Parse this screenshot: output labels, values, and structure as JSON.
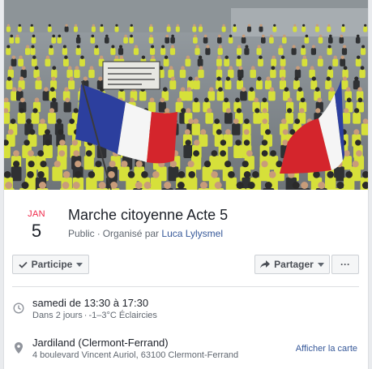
{
  "cover": {
    "banner_text": "",
    "colors": {
      "vest": "#d6e03a",
      "flag_blue": "#2c3f9e",
      "flag_red": "#d4252c",
      "flag_white": "#f5f5f5"
    }
  },
  "event": {
    "month": "JAN",
    "day": "5",
    "title": "Marche citoyenne Acte 5",
    "privacy": "Public",
    "separator": "·",
    "organized_by": "Organisé par",
    "host": "Luca Lylysmel"
  },
  "actions": {
    "going_label": "Participe",
    "share_label": "Partager",
    "more_label": "···"
  },
  "details": {
    "time": "samedi de 13:30 à 17:30",
    "countdown": "Dans 2 jours",
    "weather": "-1–3°C Éclaircies",
    "place_name": "Jardiland (Clermont-Ferrand)",
    "address": "4 boulevard Vincent Auriol, 63100 Clermont-Ferrand",
    "map_link": "Afficher la carte"
  },
  "icons": {
    "check": "check-icon",
    "share": "share-arrow-icon",
    "clock": "clock-icon",
    "pin": "location-pin-icon",
    "caret": "caret-down-icon"
  },
  "colors": {
    "accent_link": "#365899",
    "month_red": "#f02849",
    "muted": "#606770",
    "button_bg": "#f5f6f7",
    "button_border": "#ccd0d5"
  }
}
